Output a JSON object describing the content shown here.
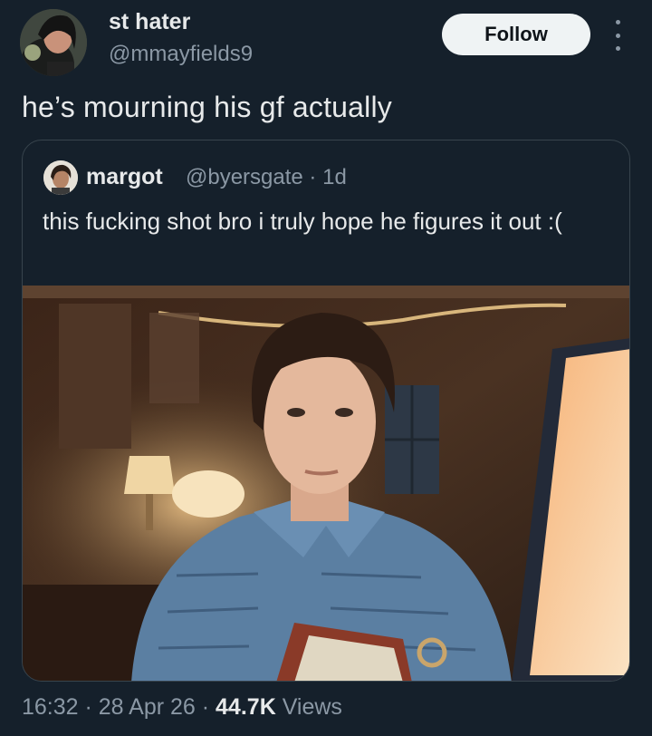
{
  "author": {
    "display_name": "st hater",
    "handle": "@mmayfields9"
  },
  "follow_label": "Follow",
  "tweet_text": "he’s mourning his gf actually",
  "quote": {
    "display_name": "margot",
    "handle_time": "@byersgate · 1d",
    "text": "this fucking shot bro i truly hope he figures it out :(",
    "media_description_icon": "photo"
  },
  "meta": {
    "time_date": "16:32 · 28 Apr 26 · ",
    "views_count": "44.7K",
    "views_label": " Views"
  },
  "colors": {
    "background": "#15202b",
    "text_primary": "#e7e9ea",
    "text_secondary": "#8b98a5",
    "border": "#38444d",
    "button_bg": "#eff3f4"
  }
}
